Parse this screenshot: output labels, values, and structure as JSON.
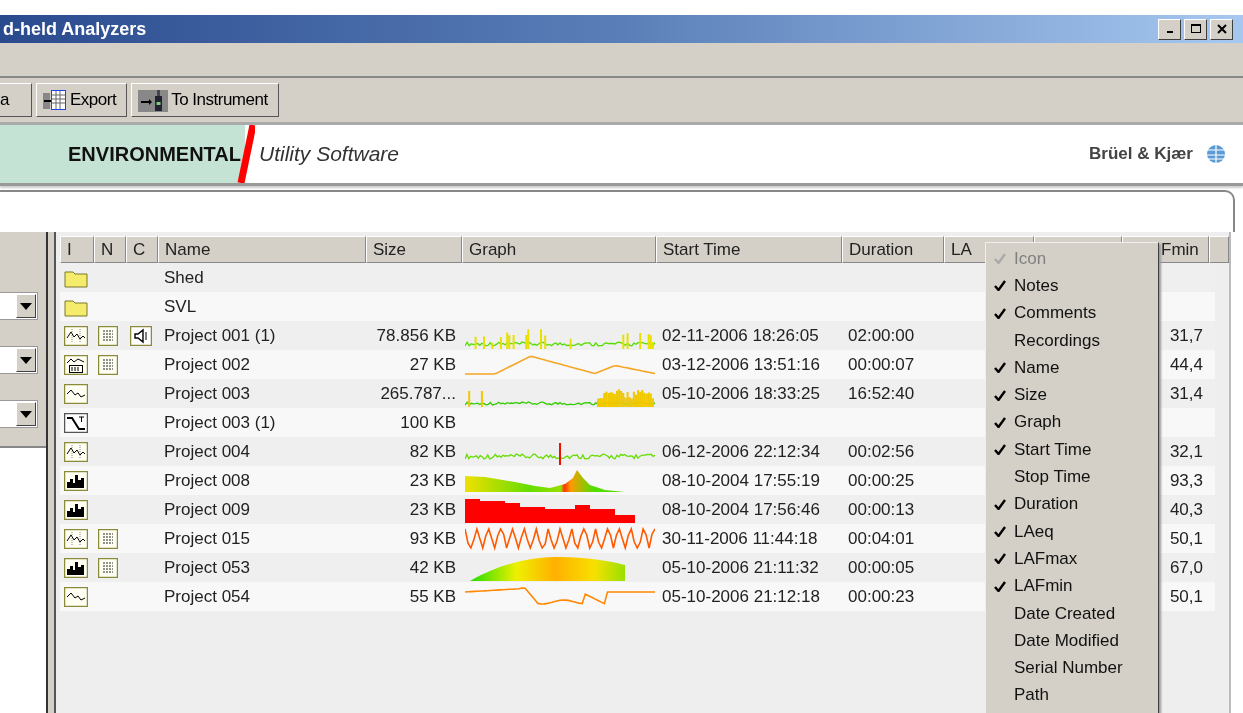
{
  "window": {
    "title": "d-held Analyzers"
  },
  "toolbar": {
    "buttons": [
      {
        "label": "a"
      },
      {
        "label": "Export"
      },
      {
        "label": "To Instrument"
      }
    ]
  },
  "banner": {
    "product": "ENVIRONMENTAL",
    "subtitle": "Utility Software",
    "brand": "Brüel & Kjær"
  },
  "table": {
    "columns": [
      {
        "label": "I"
      },
      {
        "label": "N"
      },
      {
        "label": "C"
      },
      {
        "label": "Name"
      },
      {
        "label": "Size"
      },
      {
        "label": "Graph"
      },
      {
        "label": "Start Time"
      },
      {
        "label": "Duration"
      },
      {
        "label": "LA"
      },
      {},
      {
        "label": "Fmin"
      }
    ],
    "rows": [
      {
        "kind": "folder",
        "notes": false,
        "recording": false,
        "name": "Shed"
      },
      {
        "kind": "folder",
        "notes": false,
        "recording": false,
        "name": "SVL"
      },
      {
        "kind": "profile",
        "notes": true,
        "recording": true,
        "name": "Project 001 (1)",
        "size": "78.856 KB",
        "start": "02-11-2006 18:26:05",
        "duration": "02:00:00",
        "lafmin": "31,7"
      },
      {
        "kind": "level",
        "notes": true,
        "recording": false,
        "name": "Project 002",
        "size": "27 KB",
        "start": "03-12-2006 13:51:16",
        "duration": "00:00:07",
        "lafmin": "44,4"
      },
      {
        "kind": "line",
        "notes": false,
        "recording": false,
        "name": "Project 003",
        "size": "265.787...",
        "start": "05-10-2006 18:33:25",
        "duration": "16:52:40",
        "lafmin": "31,4"
      },
      {
        "kind": "step",
        "notes": false,
        "recording": false,
        "name": "Project 003 (1)",
        "size": "100 KB"
      },
      {
        "kind": "profile",
        "notes": false,
        "recording": false,
        "name": "Project 004",
        "size": "82 KB",
        "start": "06-12-2006 22:12:34",
        "duration": "00:02:56",
        "lafmin": "32,1"
      },
      {
        "kind": "spectrum",
        "notes": false,
        "recording": false,
        "name": "Project 008",
        "size": "23 KB",
        "start": "08-10-2004 17:55:19",
        "duration": "00:00:25",
        "lafmin": "93,3"
      },
      {
        "kind": "spectrum",
        "notes": false,
        "recording": false,
        "name": "Project 009",
        "size": "23 KB",
        "start": "08-10-2004 17:56:46",
        "duration": "00:00:13",
        "lafmin": "40,3"
      },
      {
        "kind": "profile",
        "notes": true,
        "recording": false,
        "name": "Project 015",
        "size": "93 KB",
        "start": "30-11-2006 11:44:18",
        "duration": "00:04:01",
        "lafmin": "50,1"
      },
      {
        "kind": "spectrum",
        "notes": true,
        "recording": false,
        "name": "Project 053",
        "size": "42 KB",
        "start": "05-10-2006 21:11:32",
        "duration": "00:00:05",
        "lafmin": "67,0"
      },
      {
        "kind": "line",
        "notes": false,
        "recording": false,
        "name": "Project 054",
        "size": "55 KB",
        "start": "05-10-2006 21:12:18",
        "duration": "00:00:23",
        "lafmin": "50,1"
      }
    ]
  },
  "column_menu": {
    "items": [
      {
        "label": "Icon",
        "checked": true,
        "disabled": true
      },
      {
        "label": "Notes",
        "checked": true,
        "disabled": false
      },
      {
        "label": "Comments",
        "checked": true,
        "disabled": false
      },
      {
        "label": "Recordings",
        "checked": false,
        "disabled": false
      },
      {
        "label": "Name",
        "checked": true,
        "disabled": false
      },
      {
        "label": "Size",
        "checked": true,
        "disabled": false
      },
      {
        "label": "Graph",
        "checked": true,
        "disabled": false
      },
      {
        "label": "Start Time",
        "checked": true,
        "disabled": false
      },
      {
        "label": "Stop Time",
        "checked": false,
        "disabled": false
      },
      {
        "label": "Duration",
        "checked": true,
        "disabled": false
      },
      {
        "label": "LAeq",
        "checked": true,
        "disabled": false
      },
      {
        "label": "LAFmax",
        "checked": true,
        "disabled": false
      },
      {
        "label": "LAFmin",
        "checked": true,
        "disabled": false
      },
      {
        "label": "Date Created",
        "checked": false,
        "disabled": false
      },
      {
        "label": "Date Modified",
        "checked": false,
        "disabled": false
      },
      {
        "label": "Serial Number",
        "checked": false,
        "disabled": false
      },
      {
        "label": "Path",
        "checked": false,
        "disabled": false
      }
    ]
  }
}
